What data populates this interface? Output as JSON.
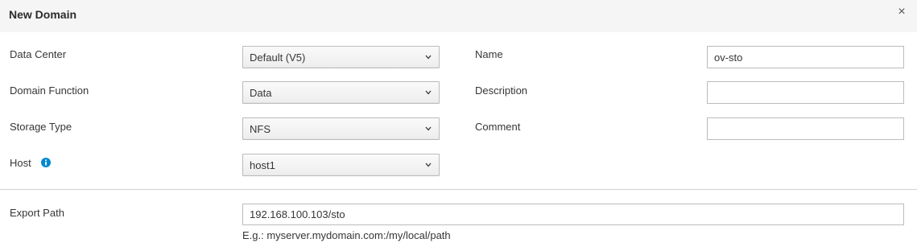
{
  "dialog": {
    "title": "New Domain",
    "close_symbol": "×"
  },
  "left": {
    "data_center": {
      "label": "Data Center",
      "value": "Default (V5)"
    },
    "domain_function": {
      "label": "Domain Function",
      "value": "Data"
    },
    "storage_type": {
      "label": "Storage Type",
      "value": "NFS"
    },
    "host": {
      "label": "Host",
      "value": "host1",
      "info_icon": "info-circle-icon"
    }
  },
  "right": {
    "name": {
      "label": "Name",
      "value": "ov-sto"
    },
    "description": {
      "label": "Description",
      "value": ""
    },
    "comment": {
      "label": "Comment",
      "value": ""
    }
  },
  "export": {
    "label": "Export Path",
    "value": "192.168.100.103/sto",
    "hint": "E.g.: myserver.mydomain.com:/my/local/path"
  },
  "colors": {
    "header_bg": "#f5f5f5",
    "info_icon": "#0088ce",
    "border": "#bbbbbb"
  }
}
